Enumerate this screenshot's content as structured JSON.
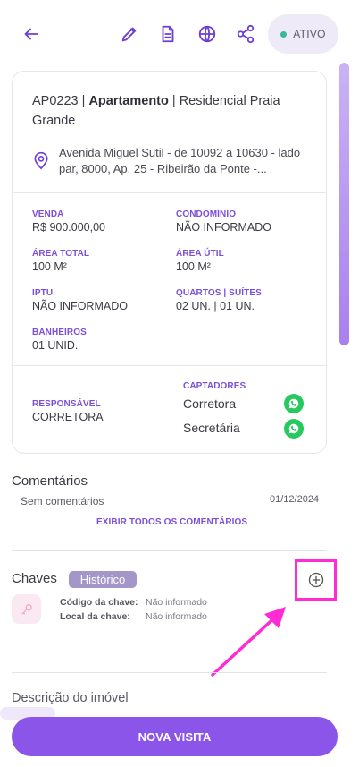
{
  "header": {
    "status_label": "ATIVO",
    "icons": [
      "back-arrow-icon",
      "pencil-icon",
      "document-icon",
      "globe-icon",
      "share-icon"
    ]
  },
  "property": {
    "code": "AP0223",
    "type": "Apartamento",
    "name_line1": "Residencial Praia",
    "name_line2": "Grande",
    "address_line1": "Avenida Miguel Sutil - de 10092 a 10630 - lado",
    "address_line2": "par, 8000, Ap. 25 - Ribeirão da Ponte -..."
  },
  "details": {
    "venda_label": "VENDA",
    "venda_value": "R$ 900.000,00",
    "condominio_label": "CONDOMÍNIO",
    "condominio_value": "NÃO INFORMADO",
    "area_total_label": "ÁREA TOTAL",
    "area_total_value": "100 M²",
    "area_util_label": "ÁREA ÚTIL",
    "area_util_value": "100 M²",
    "iptu_label": "IPTU",
    "iptu_value": "NÃO INFORMADO",
    "quartos_label": "QUARTOS | SUÍTES",
    "quartos_value": "02 UN. | 01 UN.",
    "banheiros_label": "BANHEIROS",
    "banheiros_value": "01 UNID."
  },
  "people": {
    "responsavel_label": "RESPONSÁVEL",
    "responsavel_value": "CORRETORA",
    "captadores_label": "CAPTADORES",
    "captadores": [
      "Corretora",
      "Secretária"
    ]
  },
  "comments": {
    "title": "Comentários",
    "empty_text": "Sem comentários",
    "date": "01/12/2024",
    "show_all_link": "EXIBIR TODOS OS COMENTÁRIOS"
  },
  "keys": {
    "title": "Chaves",
    "history_badge": "Histórico",
    "code_label": "Código da chave:",
    "code_value": "Não informado",
    "location_label": "Local da chave:",
    "location_value": "Não informado"
  },
  "description": {
    "title": "Descrição do imóvel"
  },
  "cta": {
    "label": "NOVA VISITA"
  },
  "colors": {
    "accent": "#8a55e8",
    "highlight": "#ff2bd6",
    "status_dot": "#3bb89b",
    "whatsapp": "#25c95d"
  }
}
